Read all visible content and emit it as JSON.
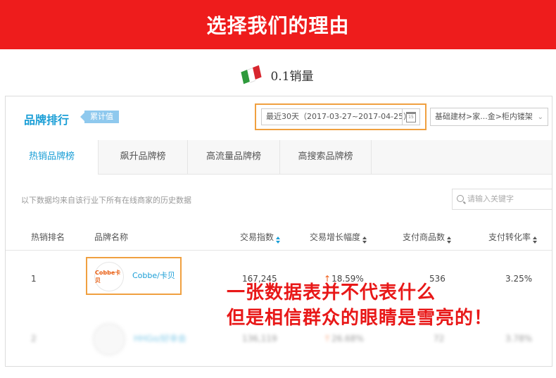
{
  "banner": {
    "title": "选择我们的理由"
  },
  "subtitle": {
    "text": "0.1销量",
    "flag_colors": [
      "#2e9a3c",
      "#ffffff",
      "#d8262e"
    ]
  },
  "panel": {
    "title": "品牌排行",
    "badge": "累计值",
    "date_range": "最近30天（2017-03-27~2017-04-25）",
    "calendar_day": "15",
    "category": "基础建材>家...金>柜内镂架",
    "tabs": [
      {
        "label": "热销品牌榜",
        "active": true
      },
      {
        "label": "飙升品牌榜",
        "active": false
      },
      {
        "label": "高流量品牌榜",
        "active": false
      },
      {
        "label": "高搜索品牌榜",
        "active": false
      }
    ],
    "note": "以下数据均来自该行业下所有在线商家的历史数据",
    "search_placeholder": "请输入关键字",
    "columns": {
      "rank": "热销排名",
      "brand": "品牌名称",
      "trade_index": "交易指数",
      "trade_growth": "交易增长幅度",
      "paid_items": "支付商品数",
      "conversion": "支付转化率"
    },
    "rows": [
      {
        "rank": "1",
        "logo": "Cobbe卡贝",
        "brand": "Cobbe/卡贝",
        "trade_index": "167,245",
        "growth": "18.59%",
        "paid_items": "536",
        "conversion": "3.25%"
      },
      {
        "rank": "2",
        "brand": "HHGo/好幸会",
        "trade_index": "136,119",
        "growth": "26.68%",
        "paid_items": "72",
        "conversion": "3.78%"
      }
    ]
  },
  "overlay": {
    "line1": "一张数据表并不代表什么",
    "line2": "但是相信群众的眼睛是雪亮的！"
  },
  "colors": {
    "banner_red": "#ee1c1c",
    "accent_blue": "#1a9ed6",
    "highlight_orange": "#f0a040",
    "overlay_red": "#e81818"
  }
}
